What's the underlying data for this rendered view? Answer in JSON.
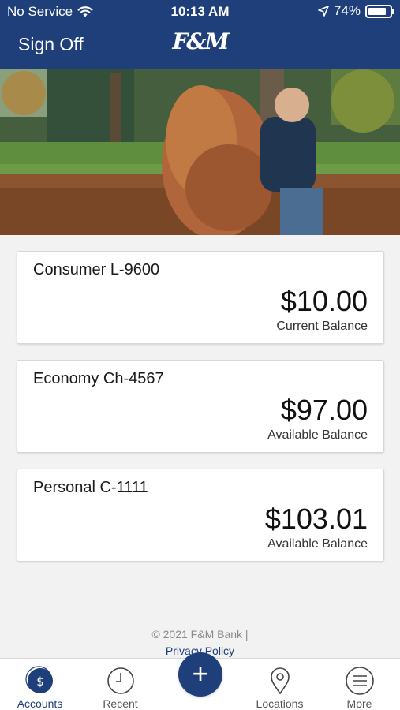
{
  "status": {
    "carrier": "No Service",
    "time": "10:13 AM",
    "battery": "74%",
    "battery_level": 0.74
  },
  "header": {
    "sign_off": "Sign Off",
    "logo": "F&M"
  },
  "accounts": [
    {
      "name": "Consumer L-9600",
      "amount": "$10.00",
      "label": "Current Balance"
    },
    {
      "name": "Economy Ch-4567",
      "amount": "$97.00",
      "label": "Available Balance"
    },
    {
      "name": "Personal C-1111",
      "amount": "$103.01",
      "label": "Available Balance"
    }
  ],
  "footer": {
    "copyright": "© 2021 F&M Bank |",
    "privacy": "Privacy Policy"
  },
  "tabs": [
    {
      "label": "Accounts",
      "icon": "dollar-circle-icon",
      "active": true
    },
    {
      "label": "Recent",
      "icon": "clock-icon"
    },
    {
      "label": "Locations",
      "icon": "map-pin-icon"
    },
    {
      "label": "More",
      "icon": "menu-icon"
    }
  ],
  "colors": {
    "brand": "#1e3f79",
    "background": "#f2f2f2"
  }
}
